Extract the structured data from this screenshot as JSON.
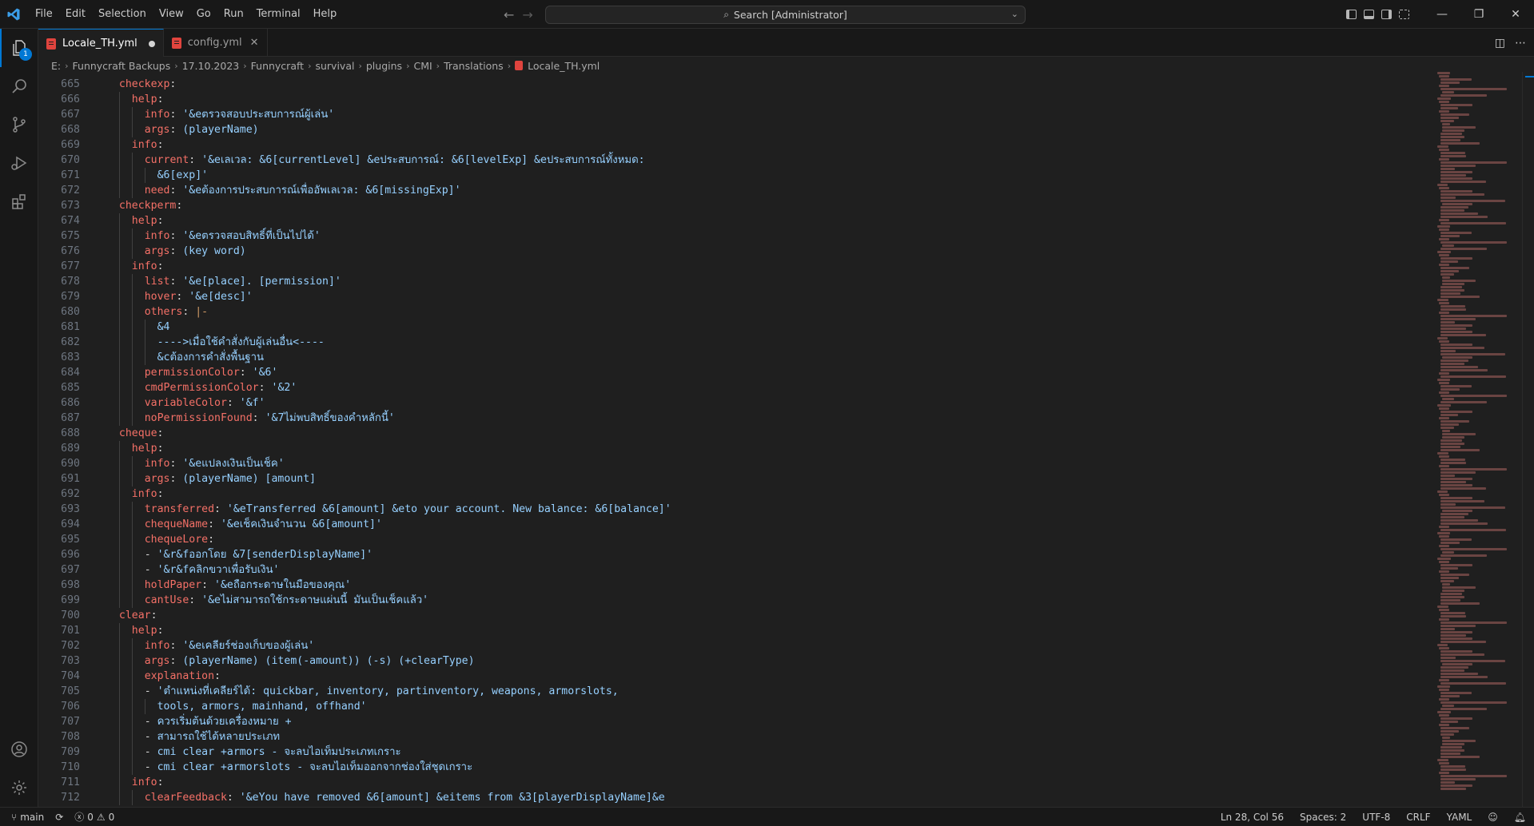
{
  "menu": [
    "File",
    "Edit",
    "Selection",
    "View",
    "Go",
    "Run",
    "Terminal",
    "Help"
  ],
  "search": {
    "label": "Search [Administrator]"
  },
  "activity_badge": "1",
  "tabs": [
    {
      "label": "Locale_TH.yml",
      "modified": true,
      "active": true
    },
    {
      "label": "config.yml",
      "modified": false,
      "active": false
    }
  ],
  "breadcrumbs": [
    "E:",
    "Funnycraft Backups",
    "17.10.2023",
    "Funnycraft",
    "survival",
    "plugins",
    "CMI",
    "Translations",
    "Locale_TH.yml"
  ],
  "editor": {
    "lines": [
      {
        "n": "665",
        "indent": 1,
        "tokens": [
          [
            "k",
            "checkexp"
          ],
          [
            "p",
            ":"
          ]
        ]
      },
      {
        "n": "666",
        "indent": 2,
        "tokens": [
          [
            "k",
            "help"
          ],
          [
            "p",
            ":"
          ]
        ]
      },
      {
        "n": "667",
        "indent": 3,
        "tokens": [
          [
            "k",
            "info"
          ],
          [
            "p",
            ": "
          ],
          [
            "s",
            "'&eตรวจสอบประสบการณ์ผู้เล่น'"
          ]
        ]
      },
      {
        "n": "668",
        "indent": 3,
        "tokens": [
          [
            "k",
            "args"
          ],
          [
            "p",
            ": "
          ],
          [
            "s",
            "(playerName)"
          ]
        ]
      },
      {
        "n": "669",
        "indent": 2,
        "tokens": [
          [
            "k",
            "info"
          ],
          [
            "p",
            ":"
          ]
        ]
      },
      {
        "n": "670",
        "indent": 3,
        "tokens": [
          [
            "k",
            "current"
          ],
          [
            "p",
            ": "
          ],
          [
            "s",
            "'&eเลเวล: &6[currentLevel] &eประสบการณ์: &6[levelExp] &eประสบการณ์ทั้งหมด:"
          ]
        ]
      },
      {
        "n": "671",
        "indent": 4,
        "tokens": [
          [
            "s",
            "&6[exp]'"
          ]
        ]
      },
      {
        "n": "672",
        "indent": 3,
        "tokens": [
          [
            "k",
            "need"
          ],
          [
            "p",
            ": "
          ],
          [
            "s",
            "'&eต้องการประสบการณ์เพื่ออัพเลเวล: &6[missingExp]'"
          ]
        ]
      },
      {
        "n": "673",
        "indent": 1,
        "tokens": [
          [
            "k",
            "checkperm"
          ],
          [
            "p",
            ":"
          ]
        ]
      },
      {
        "n": "674",
        "indent": 2,
        "tokens": [
          [
            "k",
            "help"
          ],
          [
            "p",
            ":"
          ]
        ]
      },
      {
        "n": "675",
        "indent": 3,
        "tokens": [
          [
            "k",
            "info"
          ],
          [
            "p",
            ": "
          ],
          [
            "s",
            "'&eตรวจสอบสิทธิ์ที่เป็นไปได้'"
          ]
        ]
      },
      {
        "n": "676",
        "indent": 3,
        "tokens": [
          [
            "k",
            "args"
          ],
          [
            "p",
            ": "
          ],
          [
            "s",
            "(key word)"
          ]
        ]
      },
      {
        "n": "677",
        "indent": 2,
        "tokens": [
          [
            "k",
            "info"
          ],
          [
            "p",
            ":"
          ]
        ]
      },
      {
        "n": "678",
        "indent": 3,
        "tokens": [
          [
            "k",
            "list"
          ],
          [
            "p",
            ": "
          ],
          [
            "s",
            "'&e[place]. [permission]'"
          ]
        ]
      },
      {
        "n": "679",
        "indent": 3,
        "tokens": [
          [
            "k",
            "hover"
          ],
          [
            "p",
            ": "
          ],
          [
            "s",
            "'&e[desc]'"
          ]
        ]
      },
      {
        "n": "680",
        "indent": 3,
        "tokens": [
          [
            "k",
            "others"
          ],
          [
            "p",
            ": "
          ],
          [
            "t",
            "|-"
          ]
        ]
      },
      {
        "n": "681",
        "indent": 4,
        "tokens": [
          [
            "s",
            "&4"
          ]
        ]
      },
      {
        "n": "682",
        "indent": 4,
        "tokens": [
          [
            "s",
            "---->เมื่อใช้คำสั่งกับผู้เล่นอื่น<----"
          ]
        ]
      },
      {
        "n": "683",
        "indent": 4,
        "tokens": [
          [
            "s",
            "&cต้องการคำสั่งพื้นฐาน"
          ]
        ]
      },
      {
        "n": "684",
        "indent": 3,
        "tokens": [
          [
            "k",
            "permissionColor"
          ],
          [
            "p",
            ": "
          ],
          [
            "s",
            "'&6'"
          ]
        ]
      },
      {
        "n": "685",
        "indent": 3,
        "tokens": [
          [
            "k",
            "cmdPermissionColor"
          ],
          [
            "p",
            ": "
          ],
          [
            "s",
            "'&2'"
          ]
        ]
      },
      {
        "n": "686",
        "indent": 3,
        "tokens": [
          [
            "k",
            "variableColor"
          ],
          [
            "p",
            ": "
          ],
          [
            "s",
            "'&f'"
          ]
        ]
      },
      {
        "n": "687",
        "indent": 3,
        "tokens": [
          [
            "k",
            "noPermissionFound"
          ],
          [
            "p",
            ": "
          ],
          [
            "s",
            "'&7ไม่พบสิทธิ์ของคำหลักนี้'"
          ]
        ]
      },
      {
        "n": "688",
        "indent": 1,
        "tokens": [
          [
            "k",
            "cheque"
          ],
          [
            "p",
            ":"
          ]
        ]
      },
      {
        "n": "689",
        "indent": 2,
        "tokens": [
          [
            "k",
            "help"
          ],
          [
            "p",
            ":"
          ]
        ]
      },
      {
        "n": "690",
        "indent": 3,
        "tokens": [
          [
            "k",
            "info"
          ],
          [
            "p",
            ": "
          ],
          [
            "s",
            "'&eแปลงเงินเป็นเช็ค'"
          ]
        ]
      },
      {
        "n": "691",
        "indent": 3,
        "tokens": [
          [
            "k",
            "args"
          ],
          [
            "p",
            ": "
          ],
          [
            "s",
            "(playerName) [amount]"
          ]
        ]
      },
      {
        "n": "692",
        "indent": 2,
        "tokens": [
          [
            "k",
            "info"
          ],
          [
            "p",
            ":"
          ]
        ]
      },
      {
        "n": "693",
        "indent": 3,
        "tokens": [
          [
            "k",
            "transferred"
          ],
          [
            "p",
            ": "
          ],
          [
            "s",
            "'&eTransferred &6[amount] &eto your account. New balance: &6[balance]'"
          ]
        ]
      },
      {
        "n": "694",
        "indent": 3,
        "tokens": [
          [
            "k",
            "chequeName"
          ],
          [
            "p",
            ": "
          ],
          [
            "s",
            "'&eเช็คเงินจำนวน &6[amount]'"
          ]
        ]
      },
      {
        "n": "695",
        "indent": 3,
        "tokens": [
          [
            "k",
            "chequeLore"
          ],
          [
            "p",
            ":"
          ]
        ]
      },
      {
        "n": "696",
        "indent": 3,
        "tokens": [
          [
            "p",
            "- "
          ],
          [
            "s",
            "'&r&fออกโดย &7[senderDisplayName]'"
          ]
        ]
      },
      {
        "n": "697",
        "indent": 3,
        "tokens": [
          [
            "p",
            "- "
          ],
          [
            "s",
            "'&r&fคลิกขวาเพื่อรับเงิน'"
          ]
        ]
      },
      {
        "n": "698",
        "indent": 3,
        "tokens": [
          [
            "k",
            "holdPaper"
          ],
          [
            "p",
            ": "
          ],
          [
            "s",
            "'&eถือกระดาษในมือของคุณ'"
          ]
        ]
      },
      {
        "n": "699",
        "indent": 3,
        "tokens": [
          [
            "k",
            "cantUse"
          ],
          [
            "p",
            ": "
          ],
          [
            "s",
            "'&eไม่สามารถใช้กระดาษแผ่นนี้ มันเป็นเช็คแล้ว'"
          ]
        ]
      },
      {
        "n": "700",
        "indent": 1,
        "tokens": [
          [
            "k",
            "clear"
          ],
          [
            "p",
            ":"
          ]
        ]
      },
      {
        "n": "701",
        "indent": 2,
        "tokens": [
          [
            "k",
            "help"
          ],
          [
            "p",
            ":"
          ]
        ]
      },
      {
        "n": "702",
        "indent": 3,
        "tokens": [
          [
            "k",
            "info"
          ],
          [
            "p",
            ": "
          ],
          [
            "s",
            "'&eเคลียร์ช่องเก็บของผู้เล่น'"
          ]
        ]
      },
      {
        "n": "703",
        "indent": 3,
        "tokens": [
          [
            "k",
            "args"
          ],
          [
            "p",
            ": "
          ],
          [
            "s",
            "(playerName) (item(-amount)) (-s) (+clearType)"
          ]
        ]
      },
      {
        "n": "704",
        "indent": 3,
        "tokens": [
          [
            "k",
            "explanation"
          ],
          [
            "p",
            ":"
          ]
        ]
      },
      {
        "n": "705",
        "indent": 3,
        "tokens": [
          [
            "p",
            "- "
          ],
          [
            "s",
            "'ตำแหน่งที่เคลียร์ได้: quickbar, inventory, partinventory, weapons, armorslots,"
          ]
        ]
      },
      {
        "n": "706",
        "indent": 4,
        "tokens": [
          [
            "s",
            "tools, armors, mainhand, offhand'"
          ]
        ]
      },
      {
        "n": "707",
        "indent": 3,
        "tokens": [
          [
            "p",
            "- "
          ],
          [
            "s",
            "ควรเริ่มต้นด้วยเครื่องหมาย +"
          ]
        ]
      },
      {
        "n": "708",
        "indent": 3,
        "tokens": [
          [
            "p",
            "- "
          ],
          [
            "s",
            "สามารถใช้ได้หลายประเภท"
          ]
        ]
      },
      {
        "n": "709",
        "indent": 3,
        "tokens": [
          [
            "p",
            "- "
          ],
          [
            "s",
            "cmi clear +armors - จะลบไอเท็มประเภทเกราะ"
          ]
        ]
      },
      {
        "n": "710",
        "indent": 3,
        "tokens": [
          [
            "p",
            "- "
          ],
          [
            "s",
            "cmi clear +armorslots - จะลบไอเท็มออกจากช่องใส่ชุดเกราะ"
          ]
        ]
      },
      {
        "n": "711",
        "indent": 2,
        "tokens": [
          [
            "k",
            "info"
          ],
          [
            "p",
            ":"
          ]
        ]
      },
      {
        "n": "712",
        "indent": 3,
        "tokens": [
          [
            "k",
            "clearFeedback"
          ],
          [
            "p",
            ": "
          ],
          [
            "s",
            "'&eYou have removed &6[amount] &eitems from &3[playerDisplayName]&e"
          ]
        ]
      }
    ]
  },
  "status": {
    "branch": "main",
    "errors": "0",
    "warnings": "0",
    "position": "Ln 28, Col 56",
    "spaces": "Spaces: 2",
    "encoding": "UTF-8",
    "eol": "CRLF",
    "language": "YAML"
  },
  "colors": {
    "accent": "#0078d4",
    "key": "#f47067",
    "string": "#96d0ff",
    "background": "#1f1f1f"
  }
}
